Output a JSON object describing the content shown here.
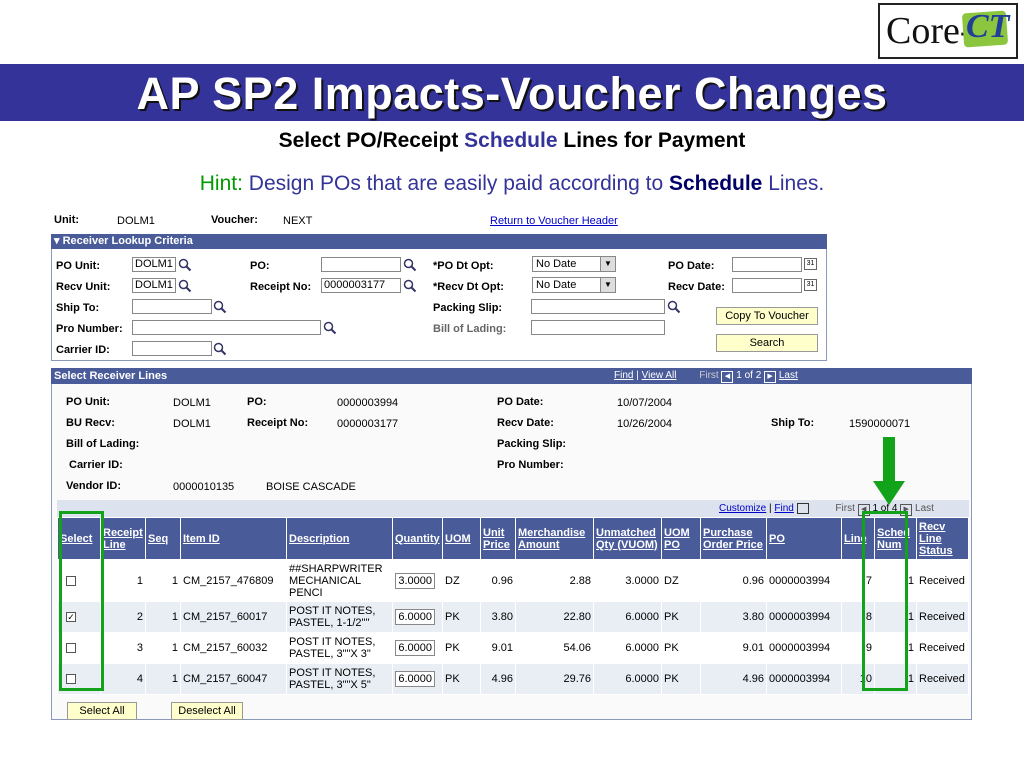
{
  "logo": {
    "text_core": "Core-",
    "text_ct": "CT"
  },
  "slide": {
    "title": "AP SP2 Impacts-Voucher Changes",
    "subtitle_a": "Select PO/Receipt ",
    "subtitle_b": "Schedule",
    "subtitle_c": " Lines for Payment",
    "hint_a": "Hint:",
    "hint_b": " Design POs that are easily paid according to ",
    "hint_c": "Schedule",
    "hint_d": " Lines."
  },
  "header": {
    "unit_label": "Unit:",
    "unit_value": "DOLM1",
    "voucher_label": "Voucher:",
    "voucher_value": "NEXT",
    "return_link": "Return to Voucher Header"
  },
  "criteria": {
    "title": "Receiver Lookup Criteria",
    "po_unit_label": "PO Unit:",
    "po_unit_value": "DOLM1",
    "recv_unit_label": "Recv Unit:",
    "recv_unit_value": "DOLM1",
    "ship_to_label": "Ship To:",
    "pro_number_label": "Pro Number:",
    "carrier_label": "Carrier ID:",
    "po_label": "PO:",
    "receipt_label": "Receipt No:",
    "receipt_value": "0000003177",
    "po_dt_opt_label": "*PO Dt Opt:",
    "po_dt_opt_value": "No Date",
    "recv_dt_opt_label": "*Recv Dt Opt:",
    "recv_dt_opt_value": "No Date",
    "packing_label": "Packing Slip:",
    "lading_label": "Bill of Lading:",
    "po_date_label": "PO Date:",
    "recv_date_label": "Recv Date:",
    "copy_button": "Copy To Voucher",
    "search_button": "Search"
  },
  "receiver": {
    "title": "Select Receiver Lines",
    "find": "Find",
    "view_all": "View All",
    "first": "First",
    "paging": "1 of 2",
    "last": "Last",
    "po_unit_label": "PO Unit:",
    "po_unit_value": "DOLM1",
    "bu_recv_label": "BU Recv:",
    "bu_recv_value": "DOLM1",
    "lading_label": "Bill of Lading:",
    "carrier_label": "Carrier ID:",
    "vendor_label": "Vendor ID:",
    "vendor_value": "0000010135",
    "vendor_name": "BOISE CASCADE",
    "po_label": "PO:",
    "po_value": "0000003994",
    "receipt_label": "Receipt No:",
    "receipt_value": "0000003177",
    "po_date_label": "PO Date:",
    "po_date_value": "10/07/2004",
    "recv_date_label": "Recv Date:",
    "recv_date_value": "10/26/2004",
    "packing_label": "Packing Slip:",
    "pro_label": "Pro Number:",
    "ship_to_label": "Ship To:",
    "ship_to_value": "1590000071"
  },
  "grid": {
    "customize": "Customize",
    "find": "Find",
    "first": "First",
    "paging": "1 of 4",
    "last": "Last",
    "columns": [
      "Select",
      "Receipt Line",
      "Seq",
      "Item ID",
      "Description",
      "Quantity",
      "UOM",
      "Unit Price",
      "Merchandise Amount",
      "Unmatched Qty (VUOM)",
      "UOM PO",
      "Purchase Order Price",
      "PO",
      "Line",
      "Sched Num",
      "Recv Line Status"
    ],
    "rows": [
      {
        "checked": false,
        "line": "1",
        "seq": "1",
        "item": "CM_2157_476809",
        "desc": "##SHARPWRITER MECHANICAL PENCI",
        "qty": "3.0000",
        "uom": "DZ",
        "price": "0.96",
        "amount": "2.88",
        "unmatched": "3.0000",
        "uom_po": "DZ",
        "po_price": "0.96",
        "po": "0000003994",
        "line_no": "7",
        "sched": "1",
        "status": "Received"
      },
      {
        "checked": true,
        "line": "2",
        "seq": "1",
        "item": "CM_2157_60017",
        "desc": "POST IT NOTES, PASTEL, 1-1/2\"\"",
        "qty": "6.0000",
        "uom": "PK",
        "price": "3.80",
        "amount": "22.80",
        "unmatched": "6.0000",
        "uom_po": "PK",
        "po_price": "3.80",
        "po": "0000003994",
        "line_no": "8",
        "sched": "1",
        "status": "Received"
      },
      {
        "checked": false,
        "line": "3",
        "seq": "1",
        "item": "CM_2157_60032",
        "desc": "POST IT NOTES, PASTEL, 3\"\"X 3\"",
        "qty": "6.0000",
        "uom": "PK",
        "price": "9.01",
        "amount": "54.06",
        "unmatched": "6.0000",
        "uom_po": "PK",
        "po_price": "9.01",
        "po": "0000003994",
        "line_no": "9",
        "sched": "1",
        "status": "Received"
      },
      {
        "checked": false,
        "line": "4",
        "seq": "1",
        "item": "CM_2157_60047",
        "desc": "POST IT NOTES, PASTEL, 3\"\"X 5\"",
        "qty": "6.0000",
        "uom": "PK",
        "price": "4.96",
        "amount": "29.76",
        "unmatched": "6.0000",
        "uom_po": "PK",
        "po_price": "4.96",
        "po": "0000003994",
        "line_no": "10",
        "sched": "1",
        "status": "Received"
      }
    ],
    "select_all": "Select All",
    "deselect_all": "Deselect All"
  },
  "colors": {
    "band": "#333399",
    "highlight": "#12a31a",
    "header_bar": "#4a5b9a"
  }
}
